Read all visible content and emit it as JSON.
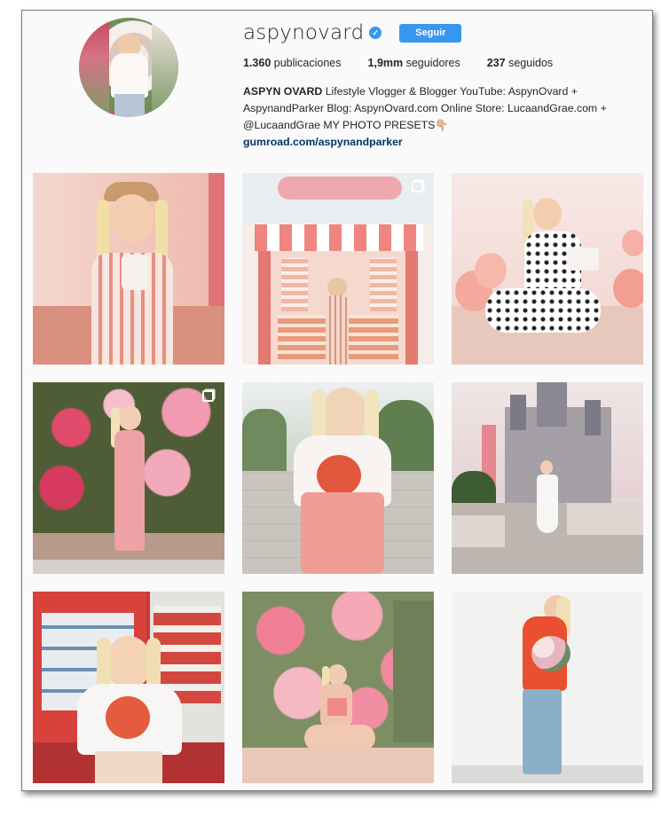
{
  "profile": {
    "username": "aspynovard",
    "follow_label": "Seguir",
    "stats": [
      {
        "value": "1.360",
        "label": "publicaciones"
      },
      {
        "value": "1,9mm",
        "label": "seguidores"
      },
      {
        "value": "237",
        "label": "seguidos"
      }
    ],
    "bio_name": "ASPYN OVARD",
    "bio_text": " Lifestyle Vlogger & Blogger YouTube: AspynOvard + AspynandParker Blog: AspynOvard.com Online Store: LucaandGrae.com + @LucaandGrae MY PHOTO PRESETS👇🏼",
    "bio_link": "gumroad.com/aspynandparker"
  },
  "posts": [
    {
      "subject": "girl-with-milkshake",
      "multi": false
    },
    {
      "subject": "pink-storefront",
      "multi": true
    },
    {
      "subject": "polka-dot-balloons",
      "multi": false
    },
    {
      "subject": "flower-bush",
      "multi": true
    },
    {
      "subject": "santa-cruz-overalls",
      "multi": false
    },
    {
      "subject": "castle",
      "multi": false
    },
    {
      "subject": "vending-machines",
      "multi": false
    },
    {
      "subject": "pink-flowers-sitting",
      "multi": false
    },
    {
      "subject": "white-wall-bouquet",
      "multi": false
    }
  ],
  "colors": {
    "accent": "#3897f0",
    "link": "#003569"
  }
}
